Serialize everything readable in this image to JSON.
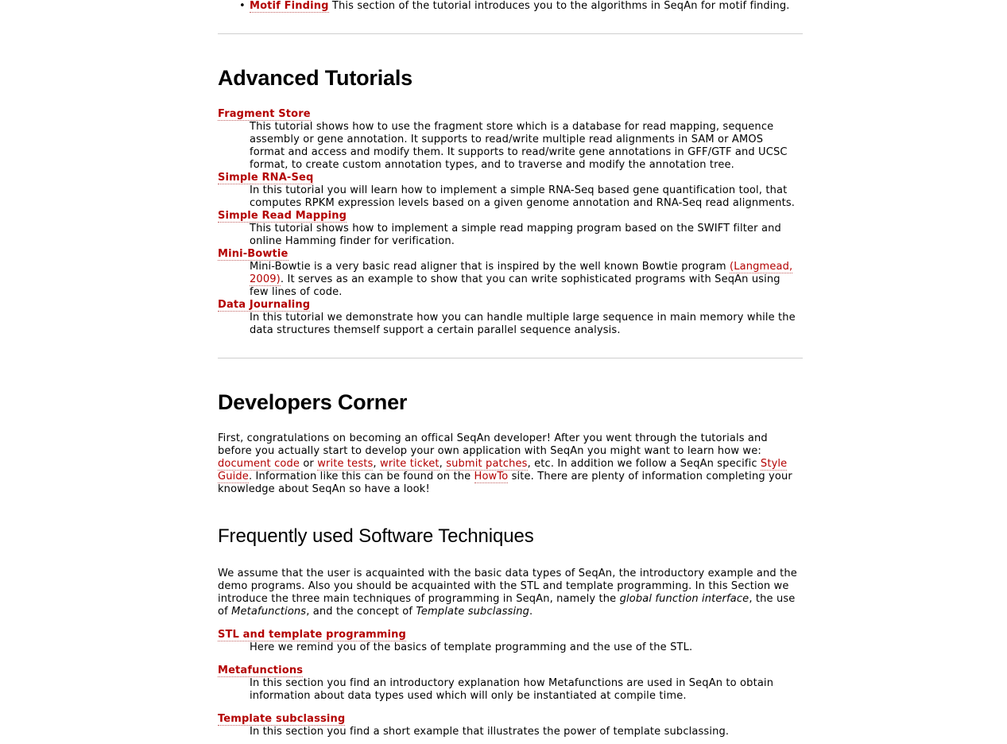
{
  "top_list": {
    "motif_finding": {
      "link": "Motif Finding",
      "text": " This section of the tutorial introduces you to the algorithms in SeqAn for motif finding."
    }
  },
  "advanced": {
    "heading": "Advanced Tutorials",
    "items": [
      {
        "title": "Fragment Store",
        "lines": [
          "This tutorial shows how to use the fragment store which is a database for read mapping, sequence",
          "assembly or gene annotation. It supports to read/write multiple read alignments in SAM or AMOS",
          "format and access and modify them. It supports to read/write gene annotations in GFF/GTF and UCSC",
          "format, to create custom annotation types, and to traverse and modify the annotation tree."
        ]
      },
      {
        "title": "Simple RNA-Seq",
        "lines": [
          "In this tutorial you will learn how to implement a simple RNA-Seq based gene quantification tool, that",
          "computes RPKM expression levels based on a given genome annotation and RNA-Seq read alignments."
        ]
      },
      {
        "title": "Simple Read Mapping",
        "lines": [
          "This tutorial shows how to implement a simple read mapping program based on the SWIFT filter and",
          "online Hamming finder for verification."
        ]
      },
      {
        "title": "Mini-Bowtie",
        "line1_text": "Mini-Bowtie is a very basic read aligner that is inspired by the well known Bowtie program ",
        "ref_part1": "(Langmead,",
        "ref_part2": "2009)",
        "line2_text": ". It serves as an example to show that you can write sophisticated programs with SeqAn using",
        "line3_text": "few lines of code."
      },
      {
        "title": "Data Journaling",
        "lines": [
          "In this tutorial we demonstrate how you can handle multiple large sequence in main memory while the",
          "data structures themself support a certain parallel sequence analysis."
        ]
      }
    ]
  },
  "developers": {
    "heading": "Developers Corner",
    "p1": "First, congratulations on becoming an offical SeqAn developer! After you went through the tutorials and",
    "p2": "before you actually start to develop your own application with SeqAn you might want to learn how we:",
    "link_document_code": "document code",
    "or": " or ",
    "link_write_tests": "write tests",
    "comma1": ", ",
    "link_write_ticket": "write ticket",
    "comma2": ", ",
    "link_submit_patches": "submit patches",
    "after_patches": ", etc. In addition we follow a SeqAn specific ",
    "link_style_1": "Style",
    "link_style_2": "Guide",
    "after_guide": ". Information like this can be found on the ",
    "link_howto": "HowTo",
    "after_howto": " site. There are plenty of information completing your",
    "p_last": "knowledge about SeqAn so have a look!"
  },
  "techniques": {
    "heading": "Frequently used Software Techniques",
    "l1": "We assume that the user is acquainted with the basic data types of SeqAn, the introductory example and the",
    "l2": "demo programs. Also you should be acquainted with the STL and template programming. In this Section we",
    "l3a": "introduce the three main techniques of programming in SeqAn, namely the ",
    "l3_em": "global function interface",
    "l3b": ", the use",
    "l4a": "of ",
    "l4_em1": "Metafunctions",
    "l4b": ", and the concept of ",
    "l4_em2": "Template subclassing",
    "l4c": ".",
    "items": [
      {
        "title": "STL and template programming",
        "lines": [
          "Here we remind you of the basics of template programming and the use of the STL."
        ]
      },
      {
        "title": "Metafunctions",
        "lines": [
          "In this section you find an introductory explanation how Metafunctions are used in SeqAn to obtain",
          "information about data types used which will only be instantiated at compile time."
        ]
      },
      {
        "title": "Template subclassing",
        "lines": [
          "In this section you find a short example that illustrates the power of template subclassing."
        ]
      }
    ]
  }
}
